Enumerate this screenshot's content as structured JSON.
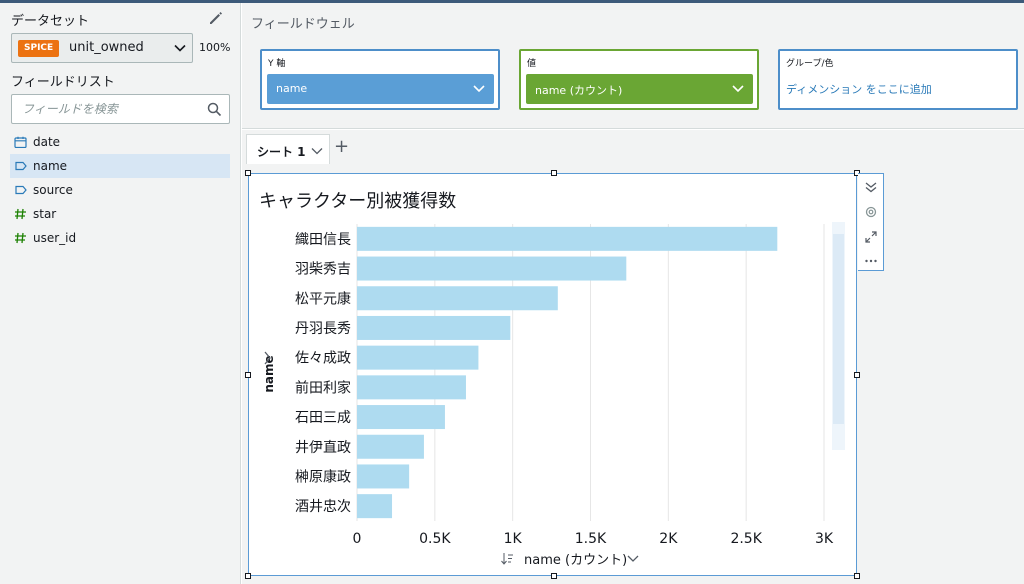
{
  "left_panel": {
    "dataset_header": "データセット",
    "dataset": {
      "badge": "SPICE",
      "name": "unit_owned",
      "percent": "100%"
    },
    "field_list_title": "フィールドリスト",
    "search_placeholder": "フィールドを検索",
    "fields": [
      {
        "name": "date",
        "icon": "calendar-icon",
        "active": false
      },
      {
        "name": "name",
        "icon": "tag-icon",
        "active": true
      },
      {
        "name": "source",
        "icon": "tag-icon",
        "active": false
      },
      {
        "name": "star",
        "icon": "hash-icon",
        "active": false
      },
      {
        "name": "user_id",
        "icon": "hash-icon",
        "active": false
      }
    ]
  },
  "field_wells": {
    "title": "フィールドウェル",
    "y_axis": {
      "label": "Y 軸",
      "value": "name",
      "color": "#5a9ed6"
    },
    "value": {
      "label": "値",
      "value": "name (カウント)",
      "color": "#6aa634"
    },
    "group": {
      "label": "グループ/色",
      "placeholder": "ディメンション をここに追加"
    }
  },
  "sheet_tabs": [
    {
      "label": "シート 1"
    }
  ],
  "colors": {
    "accent": "#5b9bd5",
    "bar": "#aedbf0",
    "spice": "#ec7211"
  },
  "chart_data": {
    "type": "bar",
    "orientation": "horizontal",
    "title": "キャラクター別被獲得数",
    "ylabel": "name",
    "xlabel": "name (カウント)",
    "categories": [
      "織田信長",
      "羽柴秀吉",
      "松平元康",
      "丹羽長秀",
      "佐々成政",
      "前田利家",
      "石田三成",
      "井伊直政",
      "榊原康政",
      "酒井忠次"
    ],
    "values": [
      2700,
      1730,
      1290,
      985,
      780,
      700,
      565,
      430,
      335,
      225
    ],
    "xlim": [
      0,
      3000
    ],
    "xticks": [
      0,
      500,
      1000,
      1500,
      2000,
      2500,
      3000
    ],
    "xtick_labels": [
      "0",
      "0.5K",
      "1K",
      "1.5K",
      "2K",
      "2.5K",
      "3K"
    ],
    "grid": true
  }
}
